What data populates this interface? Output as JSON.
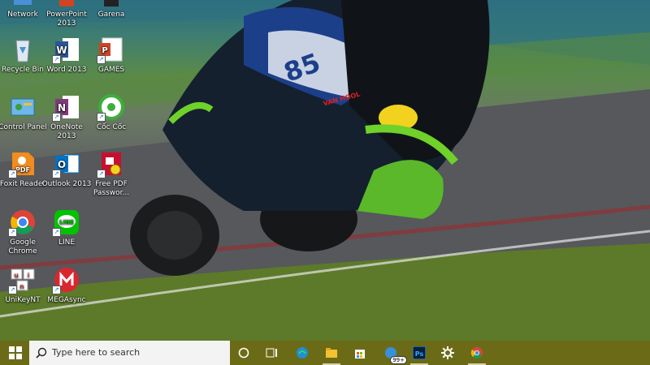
{
  "desktop": {
    "icons": [
      {
        "label": "Network",
        "icon": "network-icon"
      },
      {
        "label": "PowerPoint\n2013",
        "icon": "powerpoint-icon"
      },
      {
        "label": "Garena",
        "icon": "garena-icon"
      },
      {
        "label": "Recycle Bin",
        "icon": "recycle-bin-icon"
      },
      {
        "label": "Word 2013",
        "icon": "word-icon"
      },
      {
        "label": "GAMES",
        "icon": "games-folder-icon"
      },
      {
        "label": "Control Panel",
        "icon": "control-panel-icon"
      },
      {
        "label": "OneNote\n2013",
        "icon": "onenote-icon"
      },
      {
        "label": "Cốc Cốc",
        "icon": "coccoc-icon"
      },
      {
        "label": "Foxit Reader",
        "icon": "foxit-icon"
      },
      {
        "label": "Outlook 2013",
        "icon": "outlook-icon"
      },
      {
        "label": "Free PDF\nPasswor...",
        "icon": "free-pdf-icon"
      },
      {
        "label": "Google\nChrome",
        "icon": "chrome-icon"
      },
      {
        "label": "LINE",
        "icon": "line-icon"
      },
      {
        "label": "UniKeyNT",
        "icon": "unikey-icon"
      },
      {
        "label": "MEGAsync",
        "icon": "megasync-icon"
      }
    ],
    "wallpaper_text": {
      "bike_number": "85",
      "brand_left": "VAN HOOL",
      "brand_right": "VAN HOOL"
    }
  },
  "taskbar": {
    "search_placeholder": "Type here to search",
    "mail_badge": "99+",
    "colors": {
      "taskbar_bg": "#6b6b17",
      "search_bg": "#f3f3f3",
      "accent_underline": "#d9d0a6"
    }
  }
}
